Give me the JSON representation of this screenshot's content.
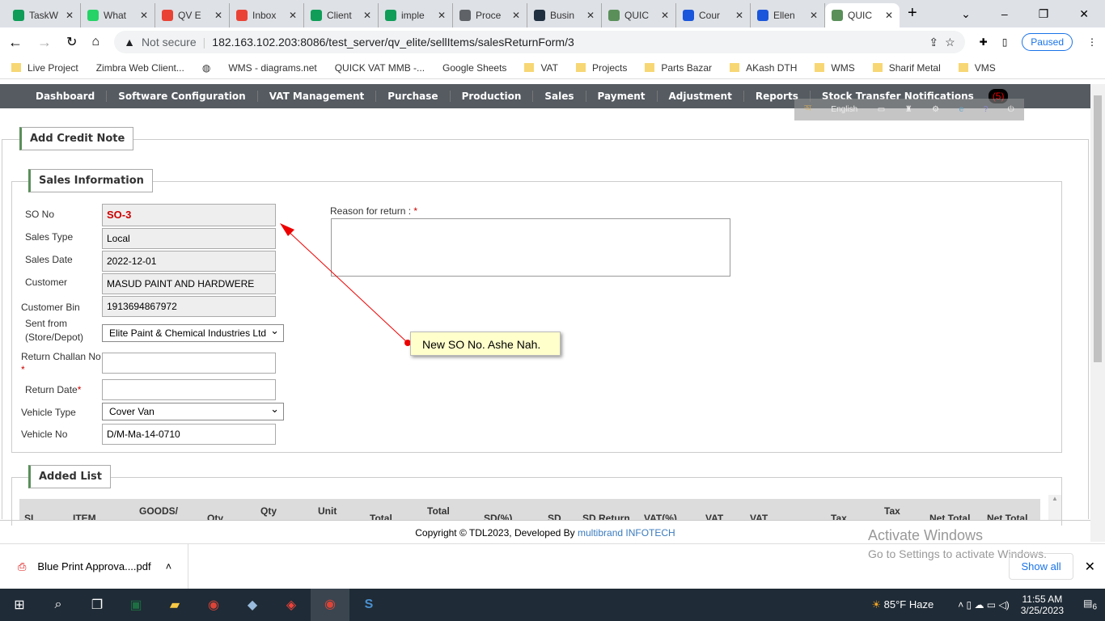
{
  "browser": {
    "tabs": [
      {
        "title": "TaskW",
        "color": "#0f9d58"
      },
      {
        "title": "What",
        "color": "#25d366"
      },
      {
        "title": "QV E",
        "color": "#e94235"
      },
      {
        "title": "Inbox",
        "color": "#ea4335"
      },
      {
        "title": "Client",
        "color": "#0f9d58"
      },
      {
        "title": "imple",
        "color": "#0f9d58"
      },
      {
        "title": "Proce",
        "color": "#5f6368"
      },
      {
        "title": "Busin",
        "color": "#203040"
      },
      {
        "title": "QUIC",
        "color": "#5a8f5a"
      },
      {
        "title": "Cour",
        "color": "#1a56db"
      },
      {
        "title": "Ellen",
        "color": "#1a56db"
      },
      {
        "title": "QUIC",
        "color": "#5a8f5a",
        "active": true
      }
    ],
    "not_secure": "Not secure",
    "url": "182.163.102.203:8086/test_server/qv_elite/sellItems/salesReturnForm/3",
    "profile": "Paused",
    "bookmarks": [
      "Live Project",
      "Zimbra Web Client...",
      "",
      "WMS - diagrams.net",
      "QUICK VAT MMB -...",
      "Google Sheets",
      "VAT",
      "Projects",
      "Parts Bazar",
      "AKash DTH",
      "WMS",
      "Sharif Metal",
      "VMS"
    ]
  },
  "nav": {
    "items": [
      "Dashboard",
      "Software Configuration",
      "VAT Management",
      "Purchase",
      "Production",
      "Sales",
      "Payment",
      "Adjustment",
      "Reports",
      "Stock Transfer Notifications"
    ],
    "badge": "(5)",
    "language": "English"
  },
  "page": {
    "title": "Add Credit Note",
    "section": "Sales Information",
    "fields": {
      "so_no_label": "SO No",
      "so_no": "SO-3",
      "sales_type_label": "Sales Type",
      "sales_type": "Local",
      "sales_date_label": "Sales Date",
      "sales_date": "2022-12-01",
      "customer_label": "Customer",
      "customer": "MASUD PAINT AND HARDWERE",
      "bin_label": "Customer Bin",
      "bin": "1913694867972",
      "sent_from_label": "Sent from",
      "sent_from_label2": "(Store/Depot)",
      "sent_from": "Elite Paint & Chemical Industries Ltd",
      "challan_label": "Return Challan No",
      "return_date_label": "Return Date",
      "vehicle_type_label": "Vehicle Type",
      "vehicle_type": "Cover Van",
      "vehicle_no_label": "Vehicle No",
      "vehicle_no": "D/M-Ma-14-0710",
      "reason_label": "Reason for return :",
      "required": "*"
    },
    "annotation": "New SO No. Ashe Nah.",
    "added_list": "Added List",
    "columns": [
      "SL",
      "ITEM",
      "GOODS/",
      "Qty",
      "Qty",
      "Unit",
      "Total",
      "Total",
      "SD(%)",
      "SD",
      "SD Return",
      "VAT(%)",
      "VAT",
      "VAT",
      "Tax",
      "Tax",
      "Net Total",
      "Net Total"
    ]
  },
  "footer": {
    "text": "Copyright © TDL2023, Developed By",
    "brand": "multibrand INFOTECH"
  },
  "watermark": {
    "title": "Activate Windows",
    "sub": "Go to Settings to activate Windows."
  },
  "download": {
    "file": "Blue Print Approva....pdf",
    "show_all": "Show all"
  },
  "taskbar": {
    "weather": "85°F  Haze",
    "time": "11:55 AM",
    "date": "3/25/2023",
    "notifications": "6"
  },
  "colors": {
    "nav": "#555b61",
    "accent": "#5a8f5a",
    "required": "#cc0000"
  }
}
